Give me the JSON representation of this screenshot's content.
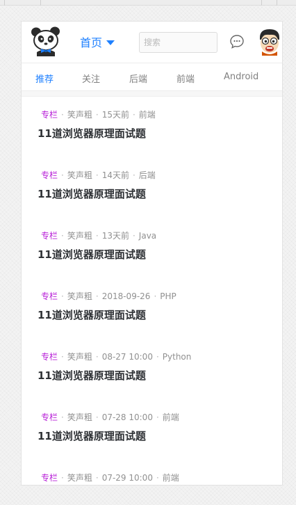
{
  "header": {
    "home_label": "首页",
    "search_placeholder": "搜索"
  },
  "colors": {
    "accent": "#1e80ff",
    "column_tag": "#b71ed7",
    "meta_text": "#909090",
    "title_text": "#2e3135"
  },
  "tabs": [
    {
      "label": "推荐",
      "active": true
    },
    {
      "label": "关注",
      "active": false
    },
    {
      "label": "后端",
      "active": false
    },
    {
      "label": "前端",
      "active": false
    },
    {
      "label": "Android",
      "active": false
    }
  ],
  "articles": [
    {
      "tag": "专栏",
      "author": "笑声粗",
      "time": "15天前",
      "category": "前端",
      "title": "11道浏览器原理面试题"
    },
    {
      "tag": "专栏",
      "author": "笑声粗",
      "time": "14天前",
      "category": "后端",
      "title": "11道浏览器原理面试题"
    },
    {
      "tag": "专栏",
      "author": "笑声粗",
      "time": "13天前",
      "category": "Java",
      "title": "11道浏览器原理面试题"
    },
    {
      "tag": "专栏",
      "author": "笑声粗",
      "time": "2018-09-26",
      "category": "PHP",
      "title": "11道浏览器原理面试题"
    },
    {
      "tag": "专栏",
      "author": "笑声粗",
      "time": "08-27 10:00",
      "category": "Python",
      "title": "11道浏览器原理面试题"
    },
    {
      "tag": "专栏",
      "author": "笑声粗",
      "time": "07-28 10:00",
      "category": "前端",
      "title": "11道浏览器原理面试题"
    },
    {
      "tag": "专栏",
      "author": "笑声粗",
      "time": "07-29 10:00",
      "category": "前端",
      "title": ""
    }
  ],
  "icons": {
    "logo": "panda-logo-icon",
    "messages": "chat-bubble-icon",
    "avatar": "cartoon-avatar"
  }
}
